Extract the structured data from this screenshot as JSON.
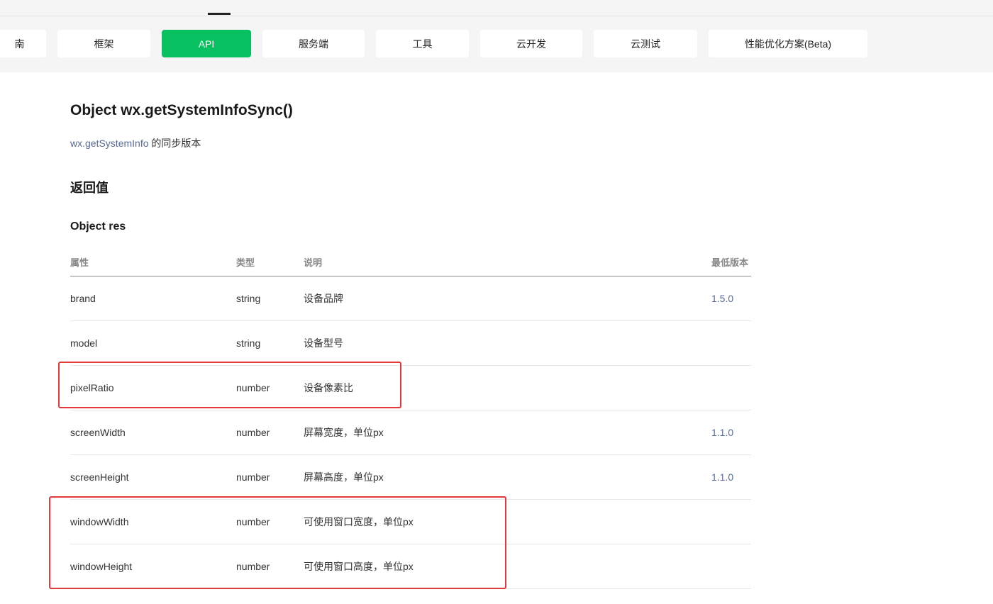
{
  "nav": {
    "tabs": [
      {
        "label": "南",
        "active": false
      },
      {
        "label": "框架",
        "active": false
      },
      {
        "label": "API",
        "active": true
      },
      {
        "label": "服务端",
        "active": false
      },
      {
        "label": "工具",
        "active": false
      },
      {
        "label": "云开发",
        "active": false
      },
      {
        "label": "云测试",
        "active": false
      },
      {
        "label": "性能优化方案(Beta)",
        "active": false
      }
    ]
  },
  "page": {
    "title": "Object wx.getSystemInfoSync()",
    "subtitle_link": "wx.getSystemInfo",
    "subtitle_rest": " 的同步版本",
    "section_title": "返回值",
    "sub_section_title": "Object res"
  },
  "table": {
    "headers": {
      "prop": "属性",
      "type": "类型",
      "desc": "说明",
      "version": "最低版本"
    },
    "rows": [
      {
        "prop": "brand",
        "type": "string",
        "desc": "设备品牌",
        "version": "1.5.0"
      },
      {
        "prop": "model",
        "type": "string",
        "desc": "设备型号",
        "version": ""
      },
      {
        "prop": "pixelRatio",
        "type": "number",
        "desc": "设备像素比",
        "version": ""
      },
      {
        "prop": "screenWidth",
        "type": "number",
        "desc": "屏幕宽度，单位px",
        "version": "1.1.0"
      },
      {
        "prop": "screenHeight",
        "type": "number",
        "desc": "屏幕高度，单位px",
        "version": "1.1.0"
      },
      {
        "prop": "windowWidth",
        "type": "number",
        "desc": "可使用窗口宽度，单位px",
        "version": ""
      },
      {
        "prop": "windowHeight",
        "type": "number",
        "desc": "可使用窗口高度，单位px",
        "version": ""
      }
    ]
  },
  "colors": {
    "accent": "#07c160",
    "link": "#576b95",
    "highlight_box": "#e03a3a"
  }
}
